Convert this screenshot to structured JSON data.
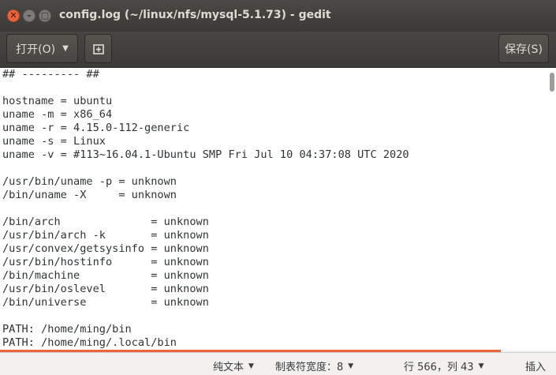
{
  "window": {
    "title": "config.log (~/linux/nfs/mysql-5.1.73) - gedit",
    "close_glyph": "✕",
    "minimize_glyph": "–",
    "maximize_glyph": "▢"
  },
  "header": {
    "open_label": "打开(O)",
    "open_caret": "▼",
    "pin_glyph": "⊞",
    "save_label": "保存(S)"
  },
  "editor": {
    "lines": [
      "## --------- ##",
      "",
      "hostname = ubuntu",
      "uname -m = x86_64",
      "uname -r = 4.15.0-112-generic",
      "uname -s = Linux",
      "uname -v = #113~16.04.1-Ubuntu SMP Fri Jul 10 04:37:08 UTC 2020",
      "",
      "/usr/bin/uname -p = unknown",
      "/bin/uname -X     = unknown",
      "",
      "/bin/arch              = unknown",
      "/usr/bin/arch -k       = unknown",
      "/usr/convex/getsysinfo = unknown",
      "/usr/bin/hostinfo      = unknown",
      "/bin/machine           = unknown",
      "/usr/bin/oslevel       = unknown",
      "/bin/universe          = unknown",
      "",
      "PATH: /home/ming/bin",
      "PATH: /home/ming/.local/bin"
    ]
  },
  "statusbar": {
    "language": "纯文本",
    "tab_width": "制表符宽度：8",
    "position": "行 566，列 43",
    "mode": "插入",
    "caret": "▼"
  },
  "colors": {
    "accent": "#e9643a",
    "titlebar": "#3c3b37",
    "editor_bg": "#ffffff",
    "text": "#2e3436"
  }
}
